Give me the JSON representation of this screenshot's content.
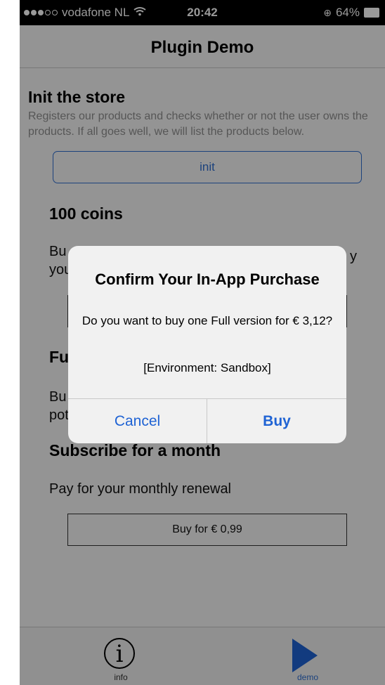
{
  "status_bar": {
    "carrier": "vodafone NL",
    "time": "20:42",
    "battery": "64%"
  },
  "nav": {
    "title": "Plugin Demo"
  },
  "init": {
    "title": "Init the store",
    "description": "Registers our products and checks whether or not the user owns the products. If all goes well, we will list the products below.",
    "button": "init"
  },
  "coins": {
    "title": "100 coins",
    "description_visible_left_line1": "Bu",
    "description_visible_left_line2": "you",
    "description_visible_right": "y"
  },
  "full": {
    "title_visible": "Fu",
    "description_visible_line1": "Bu",
    "description_visible_line2": "pot"
  },
  "subscribe": {
    "title": "Subscribe for a month",
    "description": "Pay for your monthly renewal",
    "button": "Buy for € 0,99"
  },
  "tabs": [
    {
      "label": "info",
      "icon": "info-icon",
      "active": false
    },
    {
      "label": "demo",
      "icon": "play-icon",
      "active": true
    }
  ],
  "alert": {
    "title": "Confirm Your In-App Purchase",
    "message": "Do you want to buy one Full version for € 3,12?",
    "environment": "[Environment: Sandbox]",
    "cancel": "Cancel",
    "buy": "Buy"
  },
  "colors": {
    "accent": "#2f6fd1",
    "dim_overlay": "rgba(0,0,0,0.40)"
  }
}
